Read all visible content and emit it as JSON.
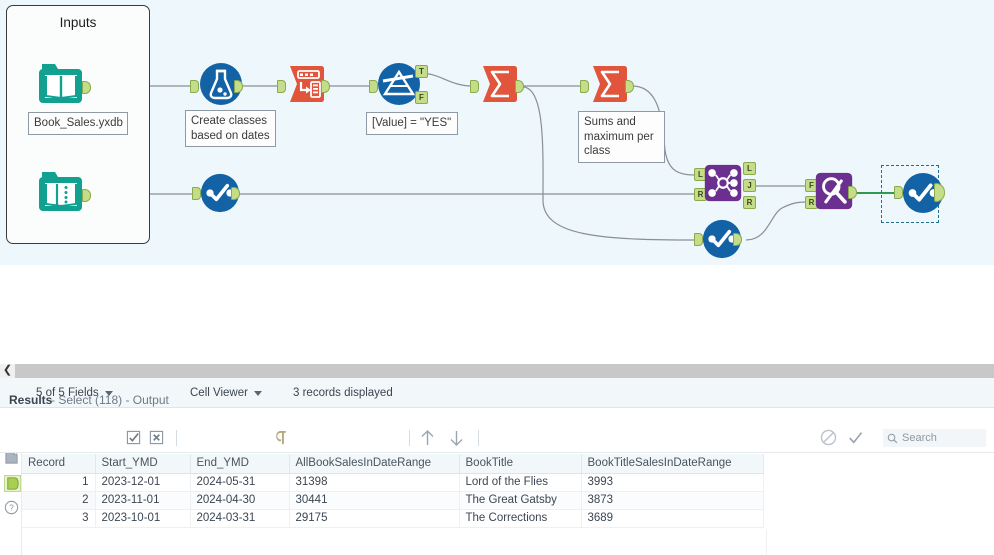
{
  "canvas": {
    "container": {
      "label": "Inputs"
    },
    "nodes": [
      {
        "id": "input1",
        "name": "input-tool-book-sales",
        "icon": "input-data-icon"
      },
      {
        "id": "input2",
        "name": "dynamic-input-tool",
        "icon": "dynamic-input-icon"
      },
      {
        "id": "formula",
        "name": "formula-tool",
        "icon": "formula-flask-icon"
      },
      {
        "id": "transpose",
        "name": "transpose-tool",
        "icon": "transpose-icon"
      },
      {
        "id": "filter",
        "name": "filter-tool",
        "icon": "filter-funnel-icon",
        "outputs": [
          "T",
          "F"
        ]
      },
      {
        "id": "summarize1",
        "name": "summarize-tool-1",
        "icon": "summarize-sigma-icon"
      },
      {
        "id": "summarize2",
        "name": "summarize-tool-2",
        "icon": "summarize-sigma-icon"
      },
      {
        "id": "join",
        "name": "join-tool",
        "icon": "join-icon",
        "inputs": [
          "L",
          "R"
        ],
        "outputs": [
          "L",
          "J",
          "R"
        ]
      },
      {
        "id": "browse1",
        "name": "browse-tool-1",
        "icon": "browse-icon"
      },
      {
        "id": "browse2",
        "name": "browse-tool-2",
        "icon": "browse-icon"
      },
      {
        "id": "findreplace",
        "name": "find-replace-tool",
        "icon": "find-replace-icon",
        "inputs": [
          "F",
          "R"
        ]
      },
      {
        "id": "browse3",
        "name": "browse-tool-selected",
        "icon": "browse-icon",
        "selected": true
      }
    ],
    "annotations": [
      {
        "id": "a1",
        "name": "annotation-book-sales",
        "text": "Book_Sales.yxdb"
      },
      {
        "id": "a2",
        "name": "annotation-formula",
        "text": "Create classes\nbased on dates"
      },
      {
        "id": "a3",
        "name": "annotation-filter",
        "text": "[Value] =  \"YES\""
      },
      {
        "id": "a4",
        "name": "annotation-summarize",
        "text": "Sums and\nmaximum per\nclass"
      }
    ],
    "colors": {
      "canvas_bg": "#eef7fb",
      "input_teal": "#12a090",
      "tool_blue": "#1262a5",
      "tool_red": "#e0553c",
      "tool_purple": "#6a2f8f",
      "anchor_green": "#c5dd88",
      "selection": "#1f6f8b",
      "connection": "#8a8f94",
      "connection_active": "#2e9b4f"
    }
  },
  "splitter": {
    "collapse_icon": "chevron-left-icon"
  },
  "results": {
    "title": "Results",
    "subtitle": "- Select (118) - Output",
    "toolbar": {
      "fields_label": "5 of 5 Fields",
      "select_all_icon": "check-box-icon",
      "deselect_all_icon": "cross-box-icon",
      "viewer_label": "Cell Viewer",
      "paragraph_icon": "pilcrow-icon",
      "records_label": "3 records displayed",
      "up_icon": "arrow-up-icon",
      "down_icon": "arrow-down-icon",
      "block_icon": "no-entry-icon",
      "check_icon": "check-icon",
      "search_icon": "search-icon",
      "search_placeholder": "Search",
      "search_value": ""
    },
    "rail": [
      {
        "name": "rail-list-icon",
        "icon": "list-icon"
      },
      {
        "name": "rail-page-icon",
        "icon": "page-icon"
      },
      {
        "name": "rail-output-icon",
        "icon": "output-anchor-icon"
      },
      {
        "name": "rail-help-icon",
        "icon": "question-icon"
      }
    ],
    "table": {
      "columns": [
        "Record",
        "Start_YMD",
        "End_YMD",
        "AllBookSalesInDateRange",
        "BookTitle",
        "BookTitleSalesInDateRange"
      ],
      "rows": [
        [
          "1",
          "2023-12-01",
          "2024-05-31",
          "31398",
          "Lord of the Flies",
          "3993"
        ],
        [
          "2",
          "2023-11-01",
          "2024-04-30",
          "30441",
          "The Great Gatsby",
          "3873"
        ],
        [
          "3",
          "2023-10-01",
          "2024-03-31",
          "29175",
          "The Corrections",
          "3689"
        ]
      ]
    }
  }
}
